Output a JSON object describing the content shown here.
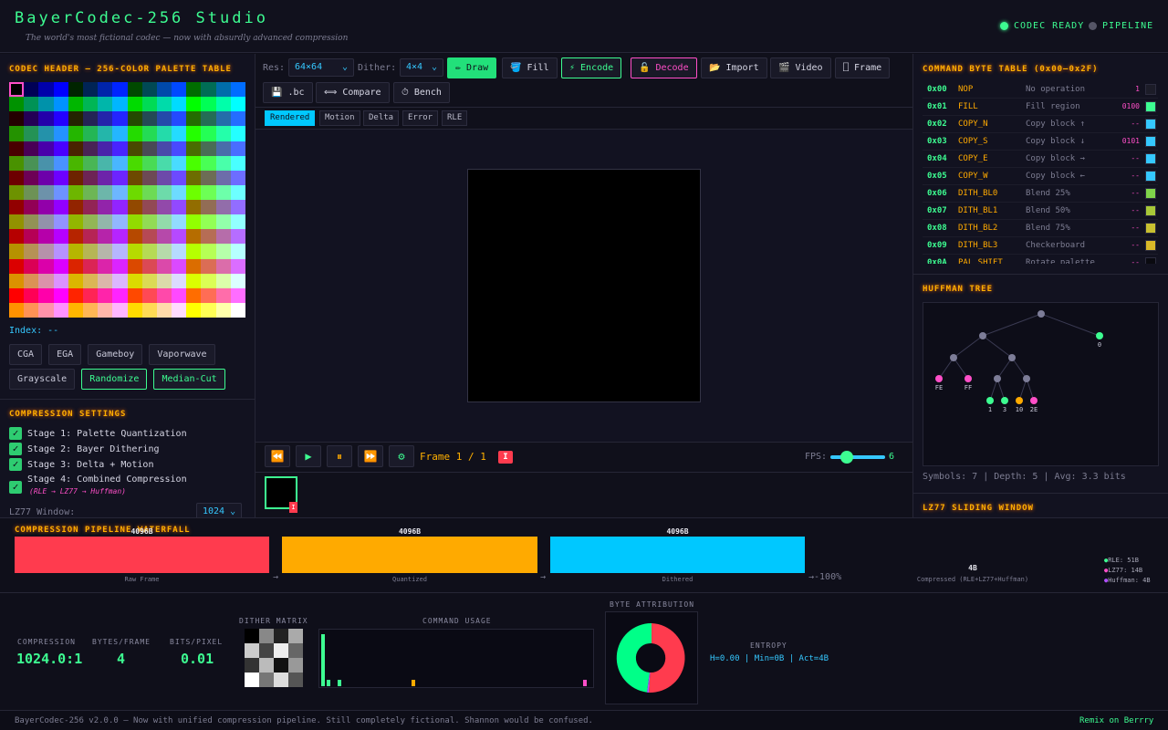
{
  "header": {
    "title": "BayerCodec-256 Studio",
    "subtitle": "The world's most fictional codec — now with absurdly advanced compression",
    "status_codec": "CODEC READY",
    "status_pipeline": "PIPELINE",
    "colors": {
      "accent": "#3dfc91",
      "idle": "#555566"
    }
  },
  "left": {
    "palette_title": "CODEC HEADER — 256-COLOR PALETTE TABLE",
    "index_label": "Index: --",
    "palette_buttons": [
      "CGA",
      "EGA",
      "Gameboy",
      "Vaporwave",
      "Grayscale",
      "Randomize",
      "Median-Cut"
    ],
    "compression_title": "COMPRESSION SETTINGS",
    "stages": [
      {
        "label": "Stage 1: Palette Quantization",
        "checked": true
      },
      {
        "label": "Stage 2: Bayer Dithering",
        "checked": true
      },
      {
        "label": "Stage 3: Delta + Motion",
        "checked": true
      },
      {
        "label": "Stage 4: Combined Compression",
        "checked": true,
        "sub": "(RLE → LZ77 → Huffman)"
      }
    ],
    "lz77_label": "LZ77 Window:",
    "lz77_value": "1024"
  },
  "toolbar": {
    "res_label": "Res:",
    "res_value": "64×64",
    "dither_label": "Dither:",
    "dither_value": "4×4",
    "draw": "✏ Draw",
    "fill": "🪣 Fill",
    "encode": "⚡ Encode",
    "decode": "🔓 Decode",
    "import": "📂 Import",
    "video": "🎬 Video",
    "frame": "⎕ Frame",
    "bc": "💾 .bc",
    "compare": "⟺ Compare",
    "bench": "⏱ Bench"
  },
  "view_tabs": [
    "Rendered",
    "Motion",
    "Delta",
    "Error",
    "RLE"
  ],
  "playback": {
    "frame_label": "Frame 1 / 1",
    "frame_badge": "I",
    "fps_label": "FPS:",
    "fps_value": "6",
    "fps_level": 0.3
  },
  "thumb_badge": "I",
  "commands": {
    "title": "COMMAND BYTE TABLE (0x00–0x2F)",
    "rows": [
      {
        "code": "0x00",
        "name": "NOP",
        "desc": "No operation",
        "val": "1",
        "color": "#1c1c28"
      },
      {
        "code": "0x01",
        "name": "FILL",
        "desc": "Fill region",
        "val": "0100",
        "color": "#3dfc91"
      },
      {
        "code": "0x02",
        "name": "COPY_N",
        "desc": "Copy block ↑",
        "val": "--",
        "color": "#35c8ff"
      },
      {
        "code": "0x03",
        "name": "COPY_S",
        "desc": "Copy block ↓",
        "val": "0101",
        "color": "#35c8ff"
      },
      {
        "code": "0x04",
        "name": "COPY_E",
        "desc": "Copy block →",
        "val": "--",
        "color": "#35c8ff"
      },
      {
        "code": "0x05",
        "name": "COPY_W",
        "desc": "Copy block ←",
        "val": "--",
        "color": "#35c8ff"
      },
      {
        "code": "0x06",
        "name": "DITH_BL0",
        "desc": "Blend 25%",
        "val": "--",
        "color": "#7fd34a"
      },
      {
        "code": "0x07",
        "name": "DITH_BL1",
        "desc": "Blend 50%",
        "val": "--",
        "color": "#a8c838"
      },
      {
        "code": "0x08",
        "name": "DITH_BL2",
        "desc": "Blend 75%",
        "val": "--",
        "color": "#c8c030"
      },
      {
        "code": "0x09",
        "name": "DITH_BL3",
        "desc": "Checkerboard",
        "val": "--",
        "color": "#d8b828"
      },
      {
        "code": "0x0A",
        "name": "PAL_SHIFT",
        "desc": "Rotate palette",
        "val": "--",
        "color": "#0a0a10"
      }
    ]
  },
  "huffman": {
    "title": "HUFFMAN TREE",
    "leaf_labels": [
      "0",
      "FE",
      "FF",
      "1",
      "3",
      "10",
      "2E"
    ],
    "stats": "Symbols: 7 | Depth: 5 | Avg: 3.3 bits"
  },
  "lz77": {
    "title": "LZ77 SLIDING WINDOW"
  },
  "pipeline": {
    "title": "COMPRESSION PIPELINE WATERFALL",
    "stages": [
      {
        "value": "4096B",
        "label": "Raw Frame",
        "color": "#ff3b4e"
      },
      {
        "value": "4096B",
        "label": "Quantized",
        "color": "#ffaa00"
      },
      {
        "value": "4096B",
        "label": "Dithered",
        "color": "#00c8ff"
      },
      {
        "value": "4B",
        "label": "Compressed (RLE+LZ77+Huffman)",
        "color": "#3dfc91"
      }
    ],
    "arrow": "→",
    "reduction": "→-100%",
    "legend": [
      {
        "label": "RLE: 51B",
        "color": "#3dfc91"
      },
      {
        "label": "LZ77: 14B",
        "color": "#ff4fc8"
      },
      {
        "label": "Huffman: 4B",
        "color": "#b04fff"
      }
    ]
  },
  "stats": {
    "compression_label": "COMPRESSION",
    "compression_value": "1024.0:1",
    "bytes_label": "BYTES/FRAME",
    "bytes_value": "4",
    "bits_label": "BITS/PIXEL",
    "bits_value": "0.01",
    "dither_title": "DITHER MATRIX",
    "command_title": "COMMAND USAGE",
    "byte_title": "BYTE ATTRIBUTION",
    "entropy_title": "ENTROPY",
    "entropy_value": "H=0.00 | Min=0B | Act=4B"
  },
  "footer": {
    "left": "BayerCodec-256 v2.0.0 — Now with unified compression pipeline. Still completely fictional. Shannon would be confused.",
    "right": "Remix on Berrry"
  }
}
